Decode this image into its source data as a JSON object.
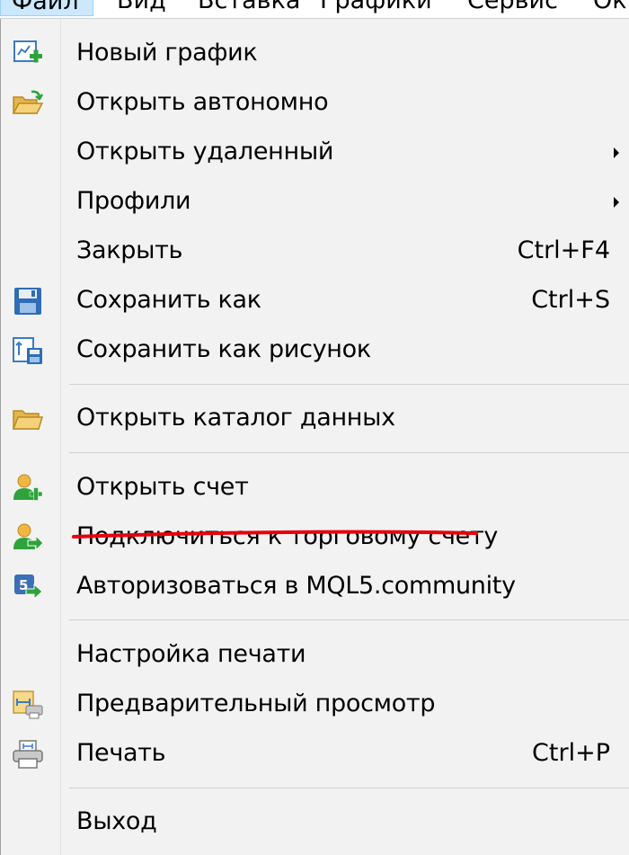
{
  "menubar": {
    "items": [
      {
        "label": "Файл"
      },
      {
        "label": "Вид"
      },
      {
        "label": "Вставка"
      },
      {
        "label": "Графики"
      },
      {
        "label": "Сервис"
      },
      {
        "label": "Ок"
      }
    ]
  },
  "menu": {
    "items": [
      {
        "label": "Новый график",
        "icon": "new-chart-icon"
      },
      {
        "label": "Открыть автономно",
        "icon": "open-folder-icon"
      },
      {
        "label": "Открыть удаленный",
        "submenu": true
      },
      {
        "label": "Профили",
        "submenu": true
      },
      {
        "label": "Закрыть",
        "shortcut": "Ctrl+F4"
      },
      {
        "label": "Сохранить как",
        "shortcut": "Ctrl+S",
        "icon": "floppy-disk-icon"
      },
      {
        "label": "Сохранить как рисунок",
        "icon": "save-picture-icon"
      },
      {
        "label": "Открыть каталог данных",
        "icon": "folder-icon"
      },
      {
        "label": "Открыть счет",
        "icon": "user-add-icon"
      },
      {
        "label": "Подключиться к торговому счету",
        "icon": "user-login-icon",
        "highlighted_underline": true
      },
      {
        "label": "Авторизоваться в MQL5.community",
        "icon": "mql5-login-icon"
      },
      {
        "label": "Настройка печати"
      },
      {
        "label": "Предварительный просмотр",
        "icon": "print-preview-icon"
      },
      {
        "label": "Печать",
        "shortcut": "Ctrl+P",
        "icon": "printer-icon"
      },
      {
        "label": "Выход"
      }
    ]
  },
  "colors": {
    "menubar_active_bg": "#cce8ff",
    "menu_bg": "#f2f2f2",
    "underline": "#e8000b"
  }
}
